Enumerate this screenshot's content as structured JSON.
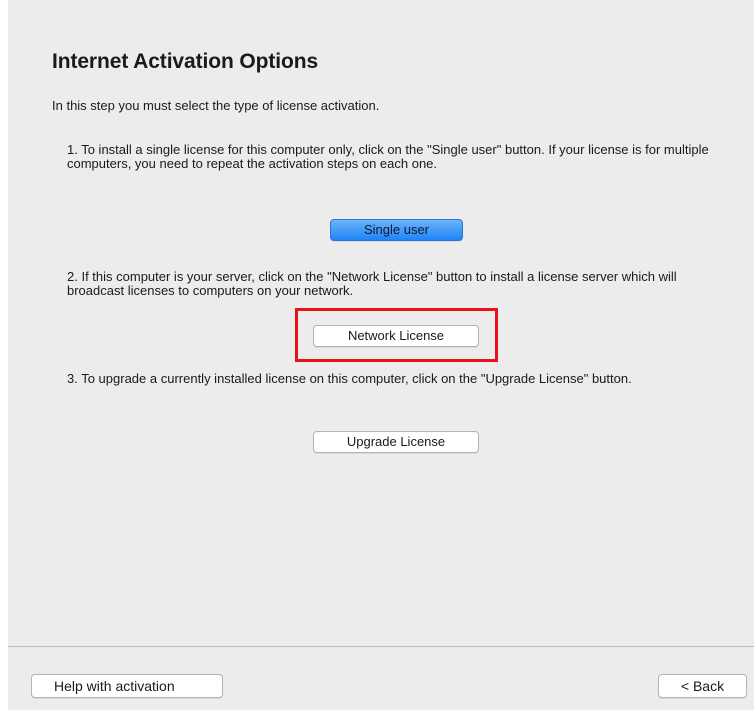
{
  "page": {
    "title": "Internet Activation Options",
    "intro": "In this step you must select the type of license activation."
  },
  "steps": [
    {
      "text": "1. To install a single license for this computer only, click on the \"Single user\" button. If your license is for multiple computers, you need to repeat the activation steps on each one.",
      "button_label": "Single user"
    },
    {
      "text": "2. If this computer is your server, click on the \"Network License\" button to install a license server which will broadcast licenses to computers on your network.",
      "button_label": "Network License"
    },
    {
      "text": "3. To upgrade a currently installed license on this computer, click on the \"Upgrade License\" button.",
      "button_label": "Upgrade License"
    }
  ],
  "footer": {
    "help_label": "Help with activation",
    "back_label": "< Back"
  },
  "colors": {
    "highlight": "#e8121b",
    "primary_button": "#1e84f6",
    "panel_background": "#ececec"
  }
}
